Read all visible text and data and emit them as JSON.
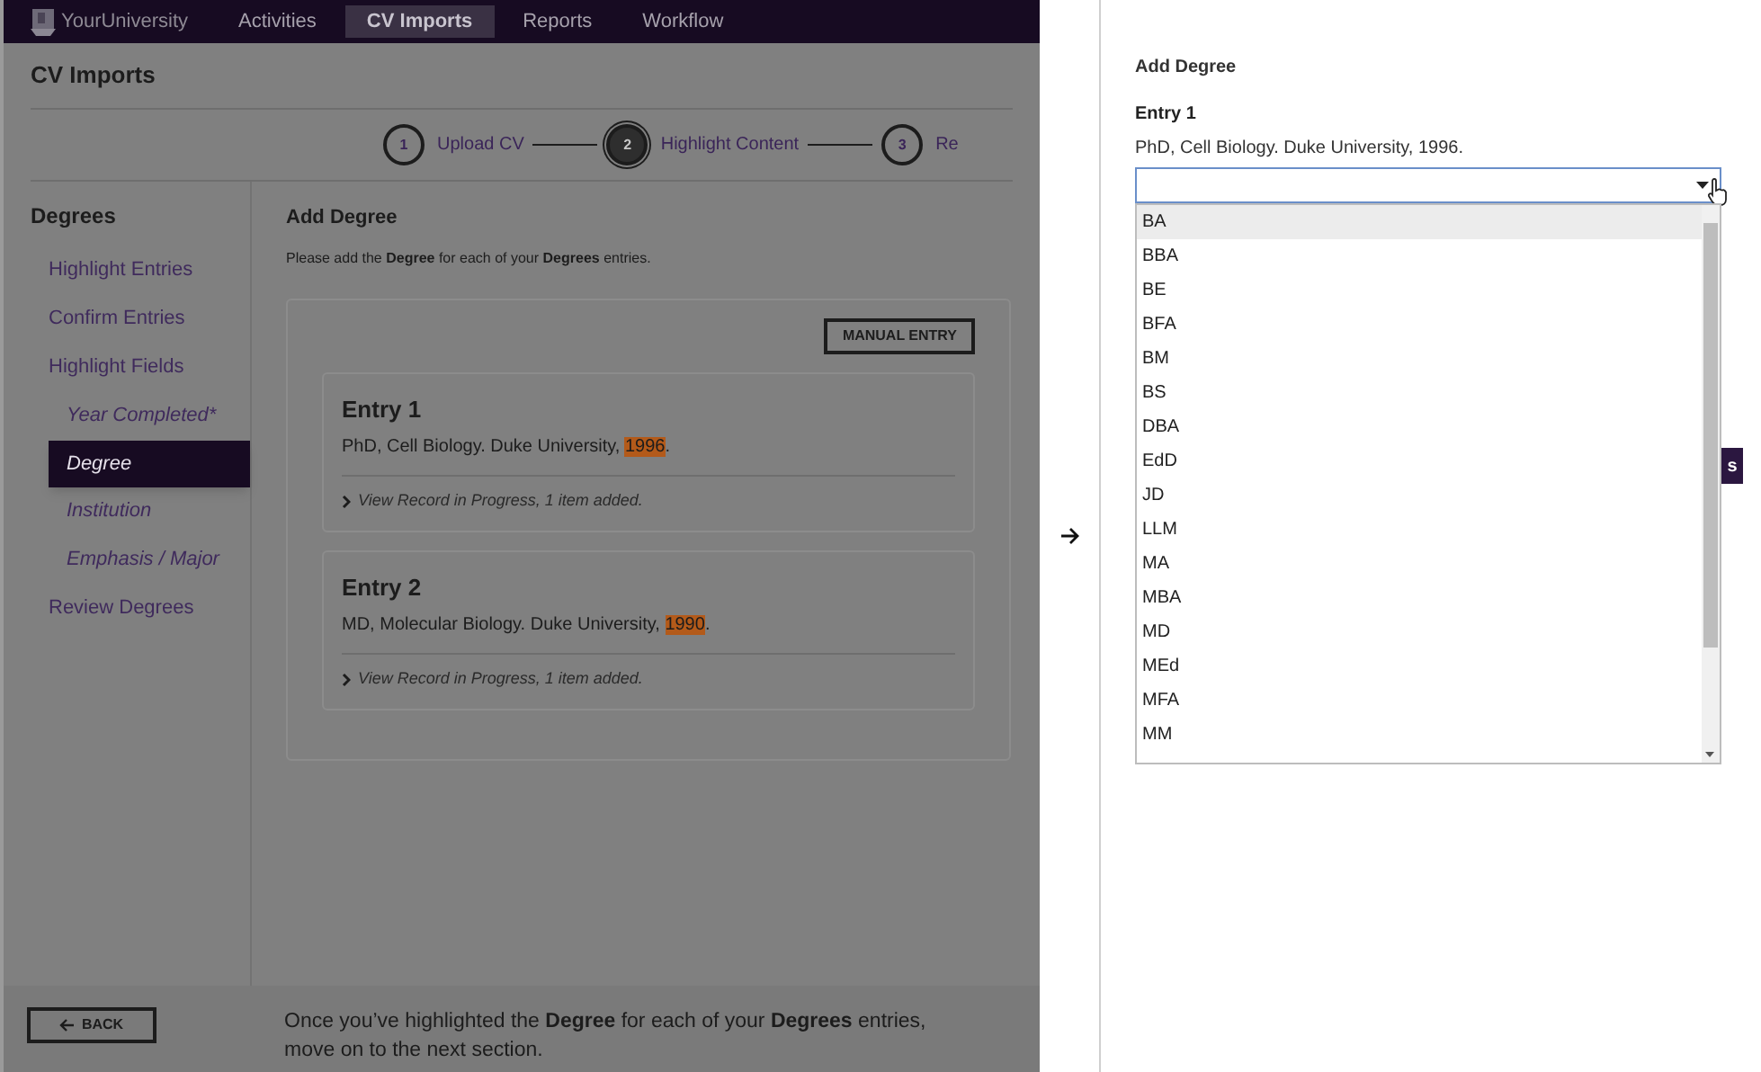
{
  "nav": {
    "logo": "YourUniversity",
    "items": [
      {
        "label": "Activities",
        "selected": false
      },
      {
        "label": "CV Imports",
        "selected": true
      },
      {
        "label": "Reports",
        "selected": false
      },
      {
        "label": "Workflow",
        "selected": false
      }
    ]
  },
  "page_title": "CV Imports",
  "steps": [
    {
      "number": "1",
      "label": "Upload CV",
      "selected": false
    },
    {
      "number": "2",
      "label": "Highlight Content",
      "selected": true
    },
    {
      "number": "3",
      "label": "Re",
      "selected": false
    }
  ],
  "sidebar": {
    "heading": "Degrees",
    "items": [
      {
        "label": "Highlight Entries",
        "selected": false
      },
      {
        "label": "Confirm Entries",
        "selected": false
      },
      {
        "label": "Highlight Fields",
        "selected": false,
        "children": [
          {
            "label": "Year Completed*",
            "selected": false
          },
          {
            "label": "Degree",
            "selected": true
          },
          {
            "label": "Institution",
            "selected": false
          },
          {
            "label": "Emphasis / Major",
            "selected": false
          }
        ]
      },
      {
        "label": "Review Degrees",
        "selected": false
      }
    ]
  },
  "main": {
    "title": "Add Degree",
    "instructions": "Please add the **Degree** for each of your **Degrees** entries.",
    "manual_entry_button": "MANUAL ENTRY",
    "entries": [
      {
        "title": "Entry 1",
        "text": "PhD, Cell Biology. Duke University, ",
        "highlight": "1996",
        "text_end": ".",
        "record_link": "View Record in Progress, 1 item added."
      },
      {
        "title": "Entry 2",
        "text": "MD, Molecular Biology. Duke University, ",
        "highlight": "1990",
        "text_end": ".",
        "record_link": "View Record in Progress, 1 item added."
      }
    ]
  },
  "footer": {
    "back_button": "BACK",
    "message": "Once you’ve highlighted the **Degree** for each of your **Degrees** entries, move on to the next section."
  },
  "detail_panel": {
    "title": "Add Degree",
    "entry_title": "Entry 1",
    "entry_text": "PhD, Cell Biology. Duke University, 1996.",
    "partial_button": "s",
    "options": [
      {
        "label": "BA",
        "selected": true
      },
      {
        "label": "BBA",
        "selected": false
      },
      {
        "label": "BE",
        "selected": false
      },
      {
        "label": "BFA",
        "selected": false
      },
      {
        "label": "BM",
        "selected": false
      },
      {
        "label": "BS",
        "selected": false
      },
      {
        "label": "DBA",
        "selected": false
      },
      {
        "label": "EdD",
        "selected": false
      },
      {
        "label": "JD",
        "selected": false
      },
      {
        "label": "LLM",
        "selected": false
      },
      {
        "label": "MA",
        "selected": false
      },
      {
        "label": "MBA",
        "selected": false
      },
      {
        "label": "MD",
        "selected": false
      },
      {
        "label": "MEd",
        "selected": false
      },
      {
        "label": "MFA",
        "selected": false
      },
      {
        "label": "MM",
        "selected": false
      }
    ]
  }
}
